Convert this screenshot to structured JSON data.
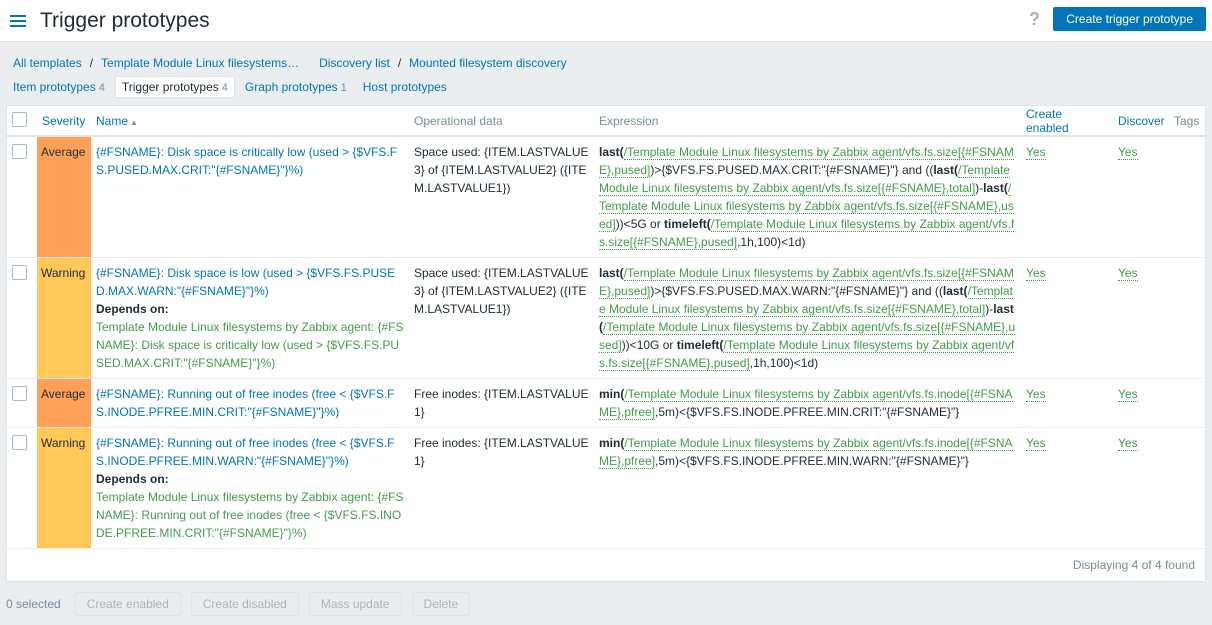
{
  "header": {
    "title": "Trigger prototypes",
    "help": "?",
    "create_button": "Create trigger prototype"
  },
  "breadcrumbs": {
    "all_templates": "All templates",
    "template": "Template Module Linux filesystems…",
    "discovery_list": "Discovery list",
    "discovery_rule": "Mounted filesystem discovery",
    "sep": "/"
  },
  "tabs": [
    {
      "label": "Item prototypes",
      "count": "4"
    },
    {
      "label": "Trigger prototypes",
      "count": "4"
    },
    {
      "label": "Graph prototypes",
      "count": "1"
    },
    {
      "label": "Host prototypes",
      "count": ""
    }
  ],
  "columns": {
    "severity": "Severity",
    "name": "Name",
    "sort_indicator": "▲",
    "operational_data": "Operational data",
    "expression": "Expression",
    "create_enabled": "Create enabled",
    "discover": "Discover",
    "tags": "Tags"
  },
  "rows": [
    {
      "severity": "Average",
      "name": "{#FSNAME}: Disk space is critically low (used > {$VFS.FS.PUSED.MAX.CRIT:\"{#FSNAME}\"}%)",
      "depends_label": "",
      "depends_on": "",
      "opdata": "Space used: {ITEM.LASTVALUE3} of {ITEM.LASTVALUE2} ({ITEM.LASTVALUE1})",
      "expr": {
        "f1": "last(",
        "l1": "/Template Module Linux filesystems by Zabbix agent/vfs.fs.size[{#FSNAME},pused]",
        "t1": ")>{$VFS.FS.PUSED.MAX.CRIT:\"{#FSNAME}\"} and ((",
        "f2": "last(",
        "l2": "/Template Module Linux filesystems by Zabbix agent/vfs.fs.size[{#FSNAME},total]",
        "t2": ")-",
        "f3": "last(",
        "l3": "/Template Module Linux filesystems by Zabbix agent/vfs.fs.size[{#FSNAME},used]",
        "t3": "))<5G or ",
        "f4": "timeleft(",
        "l4": "/Template Module Linux filesystems by Zabbix agent/vfs.fs.size[{#FSNAME},pused]",
        "t4": ",1h,100)<1d)"
      },
      "create_enabled": "Yes",
      "discover": "Yes"
    },
    {
      "severity": "Warning",
      "name": "{#FSNAME}: Disk space is low (used > {$VFS.FS.PUSED.MAX.WARN:\"{#FSNAME}\"}%)",
      "depends_label": "Depends on:",
      "depends_on": "Template Module Linux filesystems by Zabbix agent: {#FSNAME}: Disk space is critically low (used > {$VFS.FS.PUSED.MAX.CRIT:\"{#FSNAME}\"}%)",
      "opdata": "Space used: {ITEM.LASTVALUE3} of {ITEM.LASTVALUE2} ({ITEM.LASTVALUE1})",
      "expr": {
        "f1": "last(",
        "l1": "/Template Module Linux filesystems by Zabbix agent/vfs.fs.size[{#FSNAME},pused]",
        "t1": ")>{$VFS.FS.PUSED.MAX.WARN:\"{#FSNAME}\"} and ((",
        "f2": "last(",
        "l2": "/Template Module Linux filesystems by Zabbix agent/vfs.fs.size[{#FSNAME},total]",
        "t2": ")-",
        "f3": "last(",
        "l3": "/Template Module Linux filesystems by Zabbix agent/vfs.fs.size[{#FSNAME},used]",
        "t3": "))<10G or ",
        "f4": "timeleft(",
        "l4": "/Template Module Linux filesystems by Zabbix agent/vfs.fs.size[{#FSNAME},pused]",
        "t4": ",1h,100)<1d)"
      },
      "create_enabled": "Yes",
      "discover": "Yes"
    },
    {
      "severity": "Average",
      "name": "{#FSNAME}: Running out of free inodes (free < {$VFS.FS.INODE.PFREE.MIN.CRIT:\"{#FSNAME}\"}%)",
      "depends_label": "",
      "depends_on": "",
      "opdata": "Free inodes: {ITEM.LASTVALUE1}",
      "expr": {
        "f1": "min(",
        "l1": "/Template Module Linux filesystems by Zabbix agent/vfs.fs.inode[{#FSNAME},pfree]",
        "t1": ",5m)<{$VFS.FS.INODE.PFREE.MIN.CRIT:\"{#FSNAME}\"}",
        "f2": "",
        "l2": "",
        "t2": "",
        "f3": "",
        "l3": "",
        "t3": "",
        "f4": "",
        "l4": "",
        "t4": ""
      },
      "create_enabled": "Yes",
      "discover": "Yes"
    },
    {
      "severity": "Warning",
      "name": "{#FSNAME}: Running out of free inodes (free < {$VFS.FS.INODE.PFREE.MIN.WARN:\"{#FSNAME}\"}%)",
      "depends_label": "Depends on:",
      "depends_on": "Template Module Linux filesystems by Zabbix agent: {#FSNAME}: Running out of free inodes (free < {$VFS.FS.INODE.PFREE.MIN.CRIT:\"{#FSNAME}\"}%)",
      "opdata": "Free inodes: {ITEM.LASTVALUE1}",
      "expr": {
        "f1": "min(",
        "l1": "/Template Module Linux filesystems by Zabbix agent/vfs.fs.inode[{#FSNAME},pfree]",
        "t1": ",5m)<{$VFS.FS.INODE.PFREE.MIN.WARN:\"{#FSNAME}\"}",
        "f2": "",
        "l2": "",
        "t2": "",
        "f3": "",
        "l3": "",
        "t3": "",
        "f4": "",
        "l4": "",
        "t4": ""
      },
      "create_enabled": "Yes",
      "discover": "Yes"
    }
  ],
  "footer": {
    "displaying": "Displaying 4 of 4 found"
  },
  "actions": {
    "selected": "0 selected",
    "create_enabled": "Create enabled",
    "create_disabled": "Create disabled",
    "mass_update": "Mass update",
    "delete": "Delete"
  }
}
